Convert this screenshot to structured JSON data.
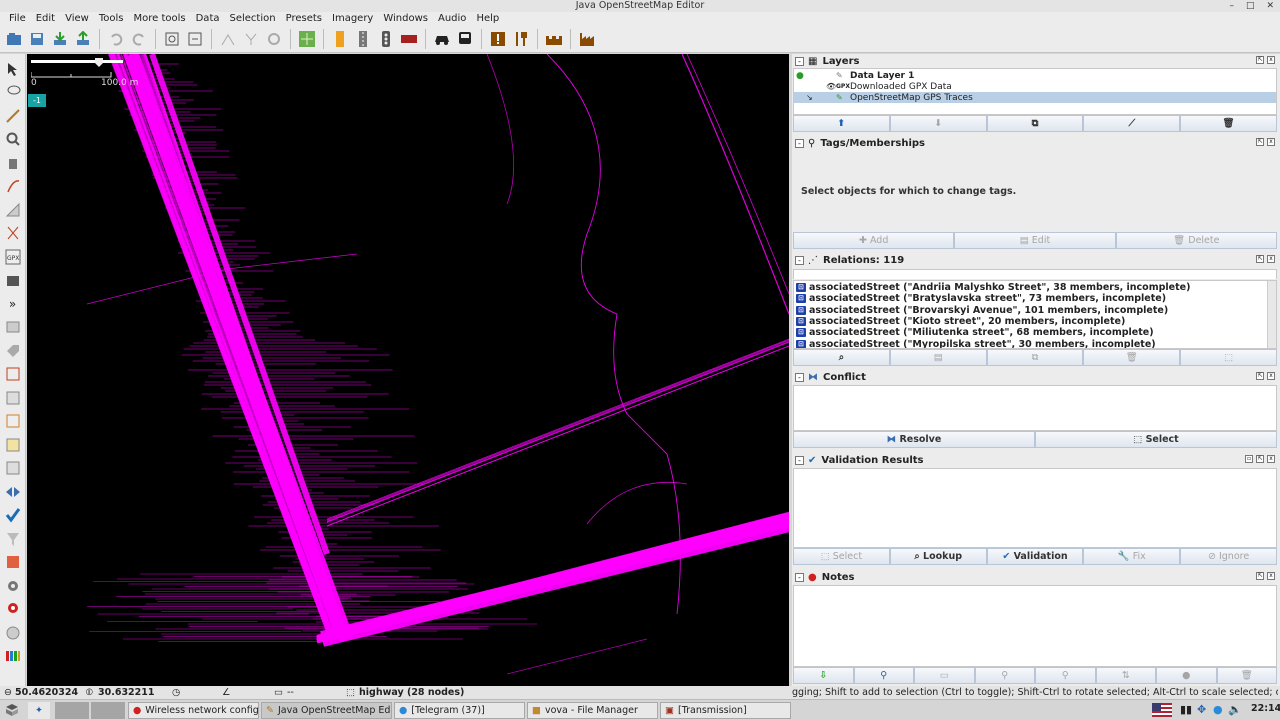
{
  "window": {
    "title": "Java OpenStreetMap Editor"
  },
  "menu": [
    "File",
    "Edit",
    "View",
    "Tools",
    "More tools",
    "Data",
    "Selection",
    "Presets",
    "Imagery",
    "Windows",
    "Audio",
    "Help"
  ],
  "map": {
    "scale_start": "0",
    "scale_end": "100.0 m",
    "layer_badge": "-1",
    "trace_color": "#ff00ff"
  },
  "layers": {
    "title": "Layers",
    "items": [
      {
        "name": "Data Layer 1",
        "active": true,
        "bold": true
      },
      {
        "name": "Downloaded GPX Data",
        "prefix": "GPX"
      },
      {
        "name": "OpenStreetMap GPS Traces",
        "selected": true
      }
    ]
  },
  "tags": {
    "title": "Tags/Memberships",
    "message": "Select objects for which to change tags.",
    "buttons": [
      "Add",
      "Edit",
      "Delete"
    ]
  },
  "relations": {
    "title": "Relations: 119",
    "items": [
      "associatedStreet (\"Andriia Malyshko Street\", 38 members, incomplete)",
      "associatedStreet (\"Bratyslavska street\", 73 members, incomplete)",
      "associatedStreet (\"Brovarskyi Avenue\", 101 members, incomplete)",
      "associatedStreet (\"Kioto street\", 20 members, incomplete)",
      "associatedStreet (\"Miliutenka street\", 68 members, incomplete)",
      "associatedStreet (\"Myropilska street\", 30 members, incomplete)"
    ]
  },
  "conflict": {
    "title": "Conflict",
    "buttons": [
      "Resolve",
      "Select"
    ]
  },
  "validation": {
    "title": "Validation Results",
    "buttons": [
      "Select",
      "Lookup",
      "Validation",
      "Fix",
      "Ignore"
    ]
  },
  "notes": {
    "title": "Notes"
  },
  "status": {
    "lat": "50.4620324",
    "lon": "30.632211",
    "heading": "",
    "angle": "",
    "distance": "--",
    "selection": "highway (28 nodes)",
    "help": "gging; Shift to add to selection (Ctrl to toggle); Shift-Ctrl to rotate selected; Alt-Ctrl to scale selected; or change selection"
  },
  "taskbar": {
    "tasks": [
      {
        "label": "Wireless network configur..."
      },
      {
        "label": "Java OpenStreetMap Editor",
        "active": true
      },
      {
        "label": "[Telegram (37)]"
      },
      {
        "label": "vova - File Manager"
      },
      {
        "label": "[Transmission]"
      }
    ],
    "clock": "22:14"
  }
}
